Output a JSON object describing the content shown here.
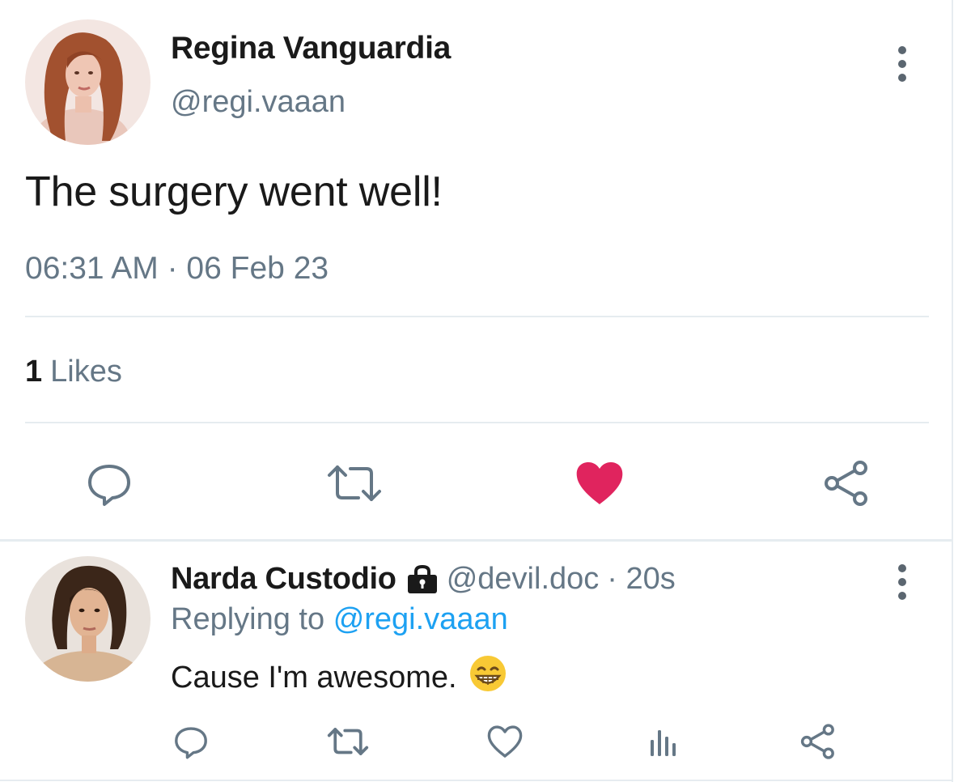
{
  "tweet": {
    "author_name": "Regina Vanguardia",
    "author_handle": "@regi.vaaan",
    "text": "The surgery went well!",
    "timestamp": "06:31 AM · 06 Feb 23",
    "likes_count": "1",
    "likes_label": "Likes",
    "liked": true,
    "like_color": "#e0245e"
  },
  "reply": {
    "author_name": "Narda Custodio",
    "author_handle": "@devil.doc",
    "time": "· 20s",
    "replying_prefix": "Replying to",
    "replying_to": "@regi.vaaan",
    "text": "Cause I'm awesome.",
    "emoji": "grinning-face-emoji",
    "mention_color": "#1da1f2"
  },
  "icons": {
    "reply": "reply-icon",
    "retweet": "retweet-icon",
    "like": "heart-icon",
    "share": "share-icon",
    "analytics": "analytics-icon",
    "more": "more-options-icon",
    "lock": "lock-icon"
  }
}
